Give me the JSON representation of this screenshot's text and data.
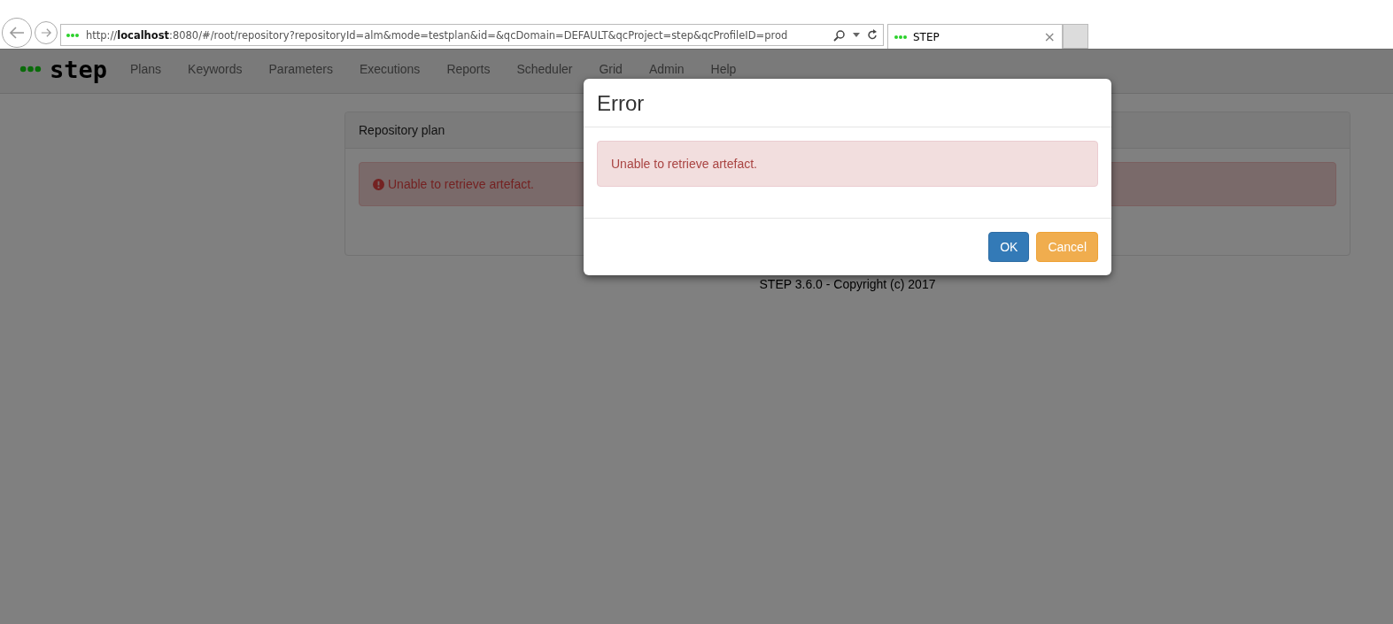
{
  "browser": {
    "url": "http://**localhost**:8080/#/root/repository?repositoryId=alm&mode=testplan&id=&qcDomain=DEFAULT&qcProject=step&qcProfileID=prod",
    "tab_title": "STEP",
    "tab_close": "×"
  },
  "app": {
    "logo": "step",
    "nav": [
      {
        "label": "Plans"
      },
      {
        "label": "Keywords"
      },
      {
        "label": "Parameters"
      },
      {
        "label": "Executions"
      },
      {
        "label": "Reports"
      },
      {
        "label": "Scheduler"
      },
      {
        "label": "Grid"
      },
      {
        "label": "Admin"
      },
      {
        "label": "Help"
      }
    ]
  },
  "panel": {
    "title": "Repository plan",
    "alert": "Unable to retrieve artefact."
  },
  "footer": "STEP 3.6.0 - Copyright (c) 2017",
  "modal": {
    "title": "Error",
    "message": "Unable to retrieve artefact.",
    "buttons": [
      {
        "label": "OK",
        "kind": "primary"
      },
      {
        "label": "Cancel",
        "kind": "warning"
      }
    ]
  }
}
